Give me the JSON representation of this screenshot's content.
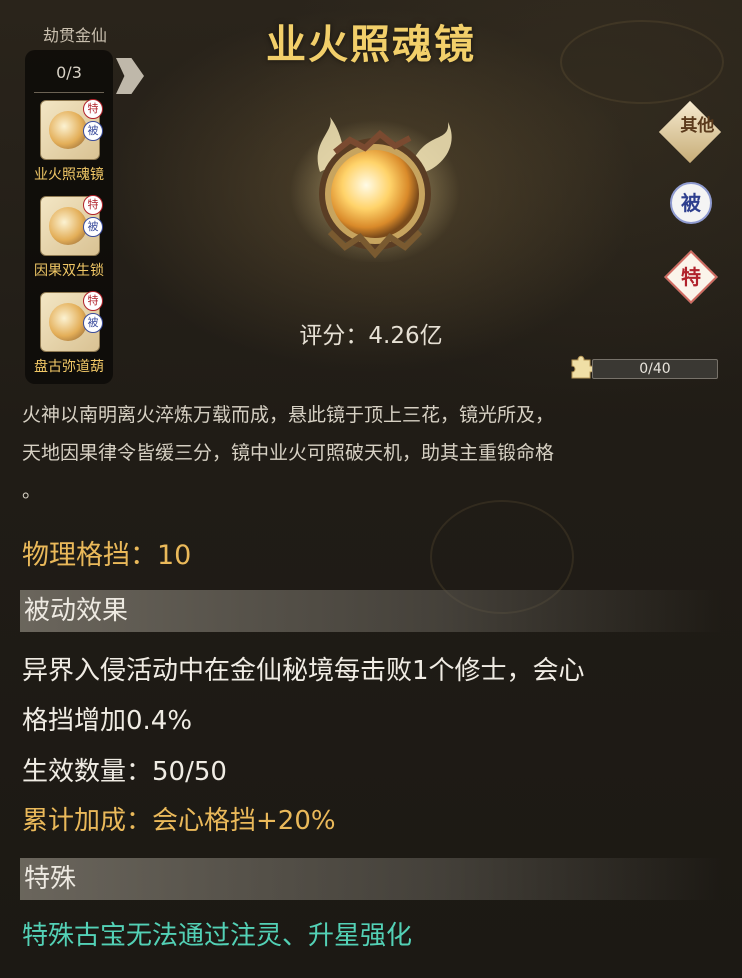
{
  "sidebar": {
    "title": "劫贯金仙",
    "counter": "0/3",
    "items": [
      {
        "label": "业火照魂镜",
        "tag_special": "特",
        "tag_passive": "被"
      },
      {
        "label": "因果双生锁",
        "tag_special": "特",
        "tag_passive": "被"
      },
      {
        "label": "盘古弥道葫",
        "tag_special": "特",
        "tag_passive": "被"
      }
    ]
  },
  "header": {
    "title": "业火照魂镜",
    "score": "评分：4.26亿"
  },
  "badges": {
    "other": "其他",
    "passive": "被",
    "special": "特"
  },
  "progress": {
    "text": "0/40",
    "fraction": 0
  },
  "description": [
    "火神以南明离火淬炼万载而成，悬此镜于顶上三花，镜光所及，",
    "天地因果律令皆缓三分，镜中业火可照破天机，助其主重锻命格",
    "。"
  ],
  "stat": "物理格挡：10",
  "passive": {
    "header": "被动效果",
    "line1": "异界入侵活动中在金仙秘境每击败1个修士，会心",
    "line2": "格挡增加0.4%",
    "count": "生效数量：50/50",
    "bonus": "累计加成：会心格挡+20%"
  },
  "special": {
    "header": "特殊",
    "text": "特殊古宝无法通过注灵、升星强化"
  }
}
